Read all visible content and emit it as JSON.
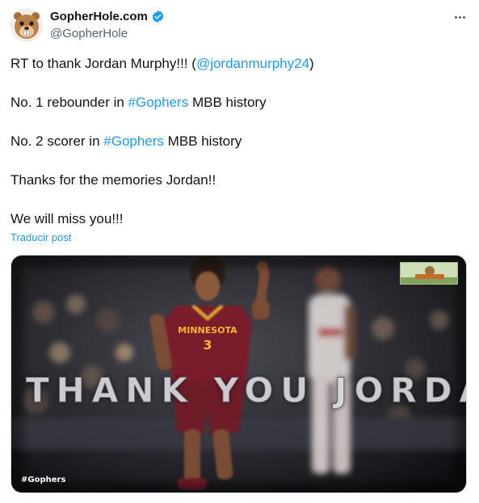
{
  "author": {
    "display_name": "GopherHole.com",
    "handle": "@GopherHole",
    "verified": true,
    "avatar_icon": "gopher-mascot-icon"
  },
  "tweet": {
    "line1_prefix": "RT to thank Jordan Murphy!!! (",
    "line1_mention": "@jordanmurphy24",
    "line1_suffix": ")",
    "line2_prefix": "No. 1 rebounder in ",
    "line2_hashtag": "#Gophers",
    "line2_suffix": " MBB history",
    "line3_prefix": "No. 2 scorer in ",
    "line3_hashtag": "#Gophers",
    "line3_suffix": " MBB history",
    "line4": "Thanks for the memories Jordan!!",
    "line5": "We will miss you!!!"
  },
  "translate_label": "Traducir post",
  "media": {
    "overlay_text": "THANK YOU JORDAN!",
    "hashtag": "#Gophers",
    "jersey_team": "MINNESOTA",
    "jersey_number": "3"
  },
  "colors": {
    "link": "#1d9bf0",
    "verified": "#1d9bf0",
    "text": "#0f1419",
    "muted": "#536471",
    "jersey": "#7a1f2b",
    "jersey_trim": "#f2b632"
  }
}
